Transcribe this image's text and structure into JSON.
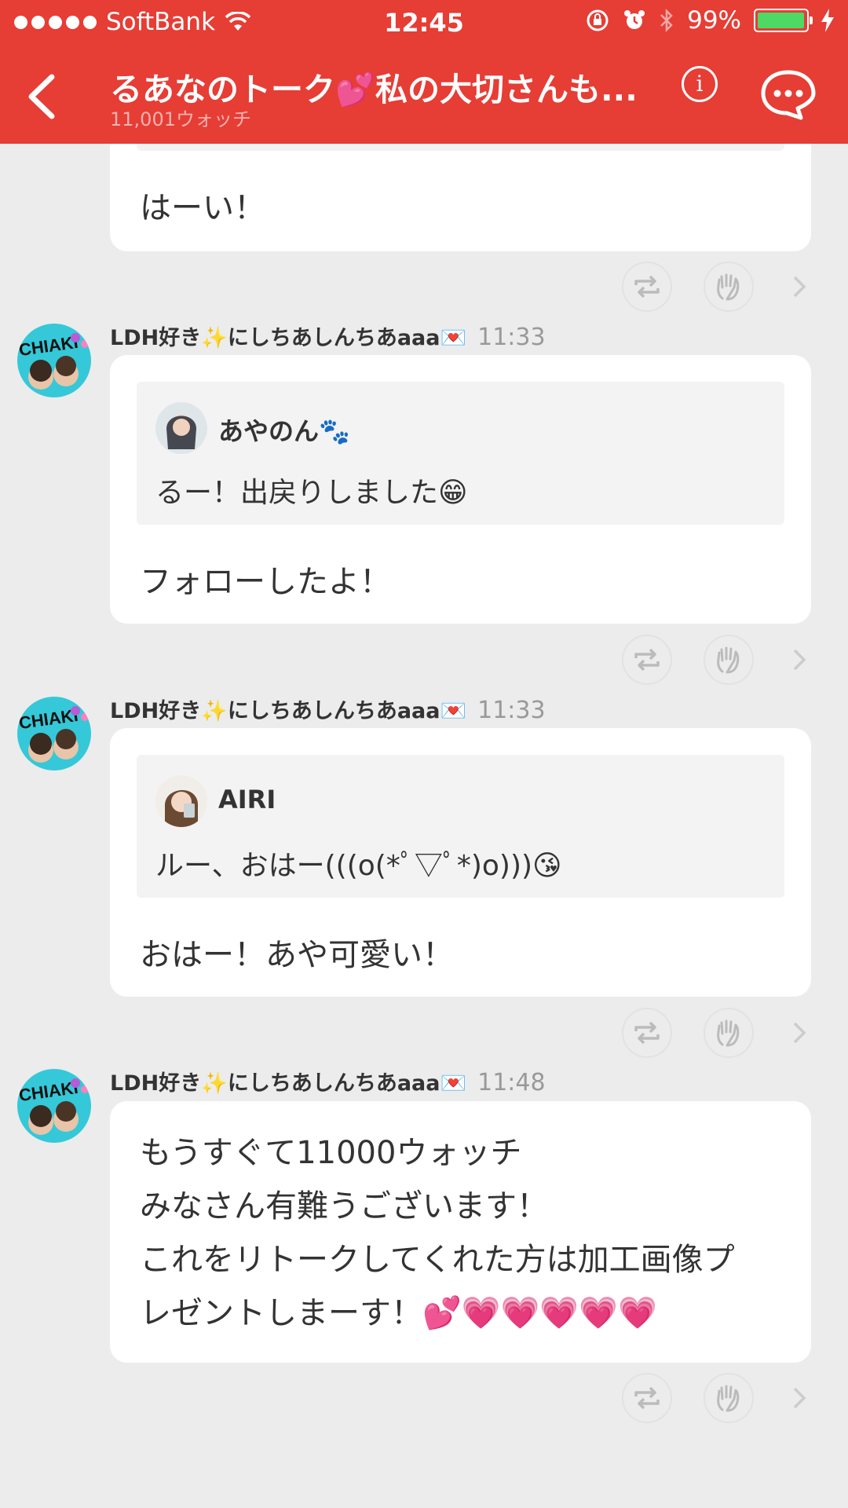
{
  "status_bar": {
    "carrier": "SoftBank",
    "time": "12:45",
    "battery_pct": "99%",
    "battery_level": 0.99
  },
  "nav": {
    "title": "るあなのトーク💕私の大切さんも...",
    "subtitle": "11,001ウォッチ",
    "info_label": "i"
  },
  "messages": [
    {
      "text": "はーい！"
    },
    {
      "author": "LDH好き✨にしちあしんちあaaa💌",
      "time": "11:33",
      "quote": {
        "name": "あやのん🐾",
        "text": "るー！出戻りしました😁"
      },
      "text": "フォローしたよ！"
    },
    {
      "author": "LDH好き✨にしちあしんちあaaa💌",
      "time": "11:33",
      "quote": {
        "name": "AIRI",
        "text": "ルー、おはー(((o(*ﾟ▽ﾟ*)o)))😘"
      },
      "text": "おはー！あや可愛い！"
    },
    {
      "author": "LDH好き✨にしちあしんちあaaa💌",
      "time": "11:48",
      "lines": [
        "もうすぐて11000ウォッチ",
        "みなさん有難うございます！",
        "これをリトークしてくれた方は加工画像プ",
        "レゼントしまーす！💕💗💗💗💗💗"
      ]
    }
  ],
  "colors": {
    "header": "#e63d35",
    "background": "#ececec",
    "card": "#ffffff",
    "quote_bg": "#f3f3f3",
    "battery": "#4cd964"
  }
}
